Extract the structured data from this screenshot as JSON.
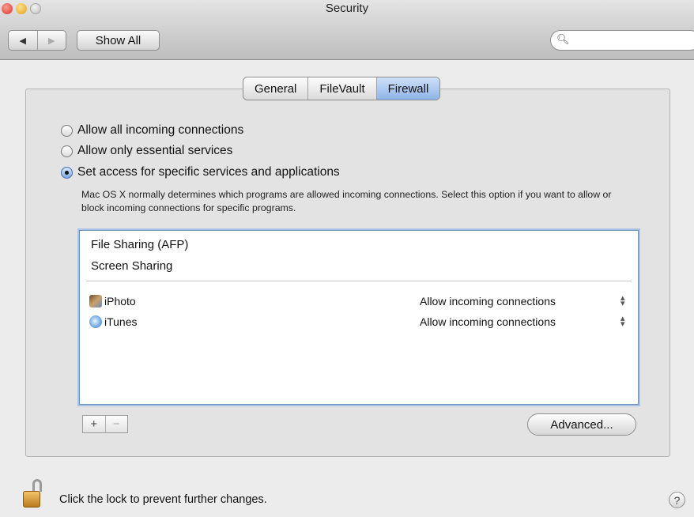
{
  "window": {
    "title": "Security"
  },
  "toolbar": {
    "back_icon": "◀",
    "forward_icon": "▶",
    "show_all_label": "Show All",
    "search_placeholder": ""
  },
  "tabs": [
    {
      "label": "General",
      "selected": false
    },
    {
      "label": "FileVault",
      "selected": false
    },
    {
      "label": "Firewall",
      "selected": true
    }
  ],
  "firewall": {
    "options": [
      {
        "label": "Allow all incoming connections",
        "selected": false
      },
      {
        "label": "Allow only essential services",
        "selected": false
      },
      {
        "label": "Set access for specific services and applications",
        "selected": true
      }
    ],
    "description": "Mac OS X normally determines which programs are allowed incoming connections. Select this option if you want to allow or block incoming connections for specific programs.",
    "services": [
      "File Sharing (AFP)",
      "Screen Sharing"
    ],
    "apps": [
      {
        "name": "iPhoto",
        "icon": "iphoto-icon",
        "permission": "Allow incoming connections"
      },
      {
        "name": "iTunes",
        "icon": "itunes-icon",
        "permission": "Allow incoming connections"
      }
    ],
    "add_label": "+",
    "remove_label": "−",
    "advanced_label": "Advanced..."
  },
  "footer": {
    "lock_text": "Click the lock to prevent further changes.",
    "help_label": "?"
  }
}
